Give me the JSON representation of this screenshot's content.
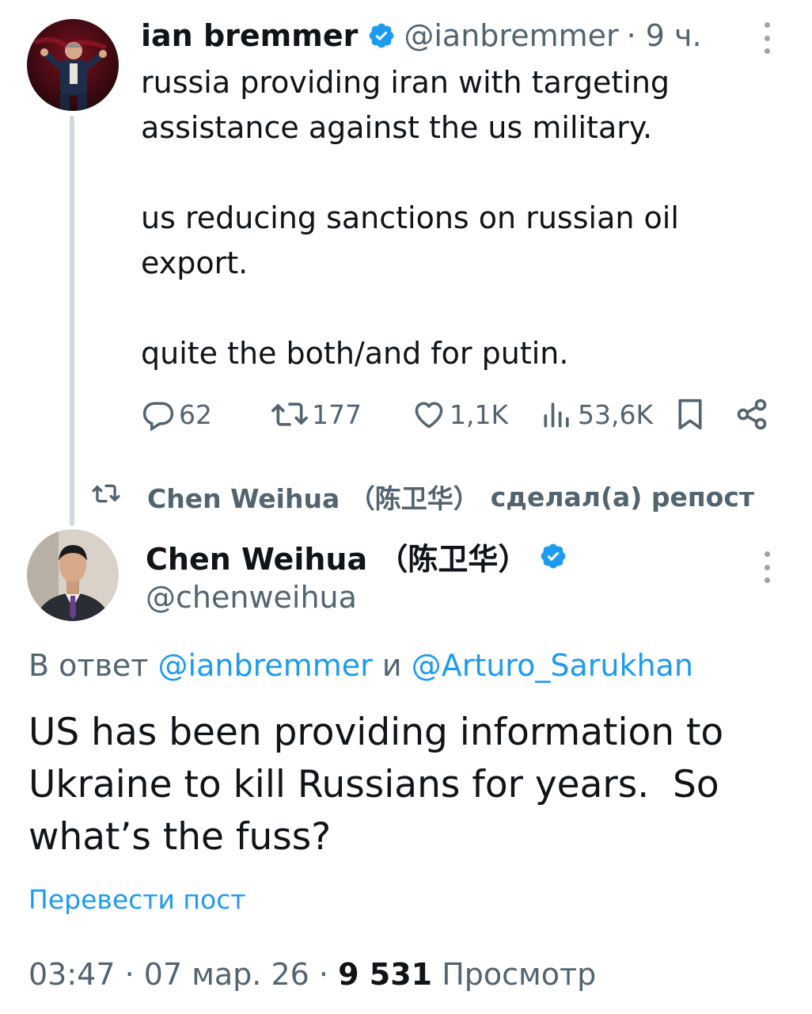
{
  "tweet1": {
    "author_name": "ian bremmer",
    "handle": "@ianbremmer",
    "time": "· 9 ч.",
    "paragraphs": [
      "russia providing iran with targeting assistance against the us military.",
      "us reducing sanctions on russian oil export.",
      "quite the both/and for putin."
    ],
    "stats": {
      "replies": "62",
      "reposts": "177",
      "likes": "1,1K",
      "views": "53,6K"
    }
  },
  "repost": {
    "reposter_name": "Chen Weihua （陈卫华）",
    "action": "сделал(а) репост"
  },
  "tweet2": {
    "author_name": "Chen Weihua （陈卫华）",
    "handle": "@chenweihua",
    "reply_prefix": "В ответ",
    "reply_mention1": "@ianbremmer",
    "reply_conj": "и",
    "reply_mention2": "@Arturo_Sarukhan",
    "text_lines": [
      "US has been providing information to",
      "Ukraine to kill Russians for years.  So",
      "what’s the fuss?"
    ],
    "translate_label": "Перевести пост",
    "time": "03:47",
    "date": "07 мар. 26",
    "sep": "·",
    "views_count": "9 531",
    "views_label": "Просмотр"
  },
  "colors": {
    "text": "#0f1419",
    "muted": "#536471",
    "link": "#1d9bf0",
    "verified": "#1d9bf0",
    "thread_line": "#cfd9de"
  },
  "icons": [
    "verified-badge-icon",
    "more-options-icon",
    "reply-icon",
    "repost-icon",
    "like-icon",
    "views-icon",
    "bookmark-icon",
    "share-icon"
  ]
}
